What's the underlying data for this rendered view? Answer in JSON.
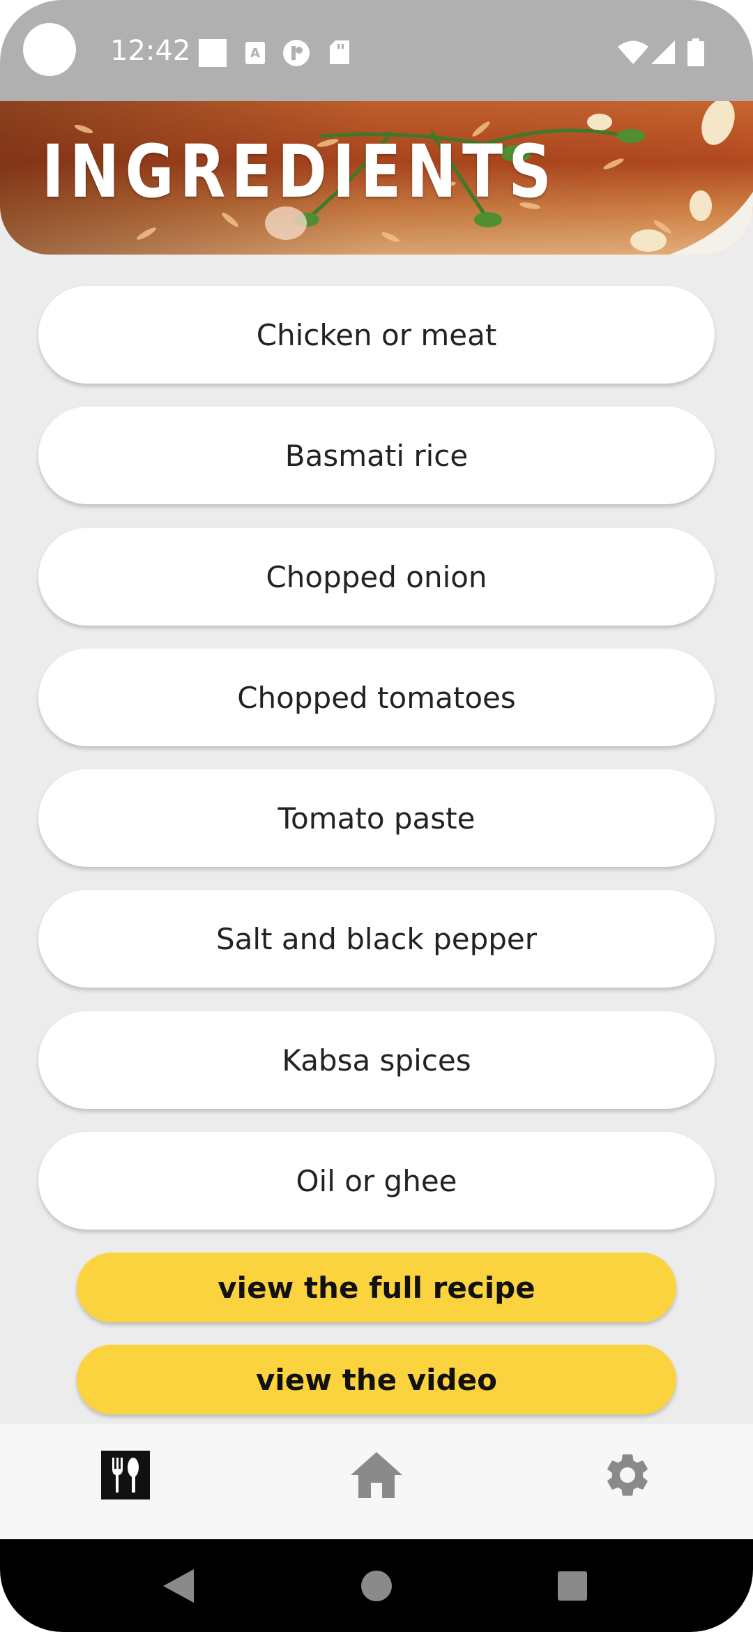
{
  "status_bar": {
    "time": "12:42",
    "icons": [
      "square-notification-icon",
      "translate-icon",
      "pocket-icon",
      "sd-card-icon",
      "wifi-icon",
      "signal-icon",
      "battery-icon"
    ]
  },
  "header": {
    "title": "INGREDIENTS"
  },
  "ingredients": [
    {
      "label": "Chicken or meat"
    },
    {
      "label": "Basmati rice"
    },
    {
      "label": "Chopped onion"
    },
    {
      "label": "Chopped tomatoes"
    },
    {
      "label": "Tomato paste"
    },
    {
      "label": "Salt and black pepper"
    },
    {
      "label": "Kabsa spices"
    },
    {
      "label": "Oil or ghee"
    }
  ],
  "actions": {
    "full_recipe_label": "view the full recipe",
    "video_label": "view the video"
  },
  "bottom_nav": {
    "items": [
      {
        "icon": "restaurant-icon",
        "active": true
      },
      {
        "icon": "home-icon",
        "active": false
      },
      {
        "icon": "gear-icon",
        "active": false
      }
    ]
  },
  "system_nav": {
    "icons": [
      "back-icon",
      "home-circle-icon",
      "recents-icon"
    ]
  },
  "colors": {
    "status_bar": "#b0b0b0",
    "background": "#ececec",
    "button_yellow": "#fbd33f",
    "nav_active": "#111111",
    "nav_inactive": "#8a8a8a"
  }
}
